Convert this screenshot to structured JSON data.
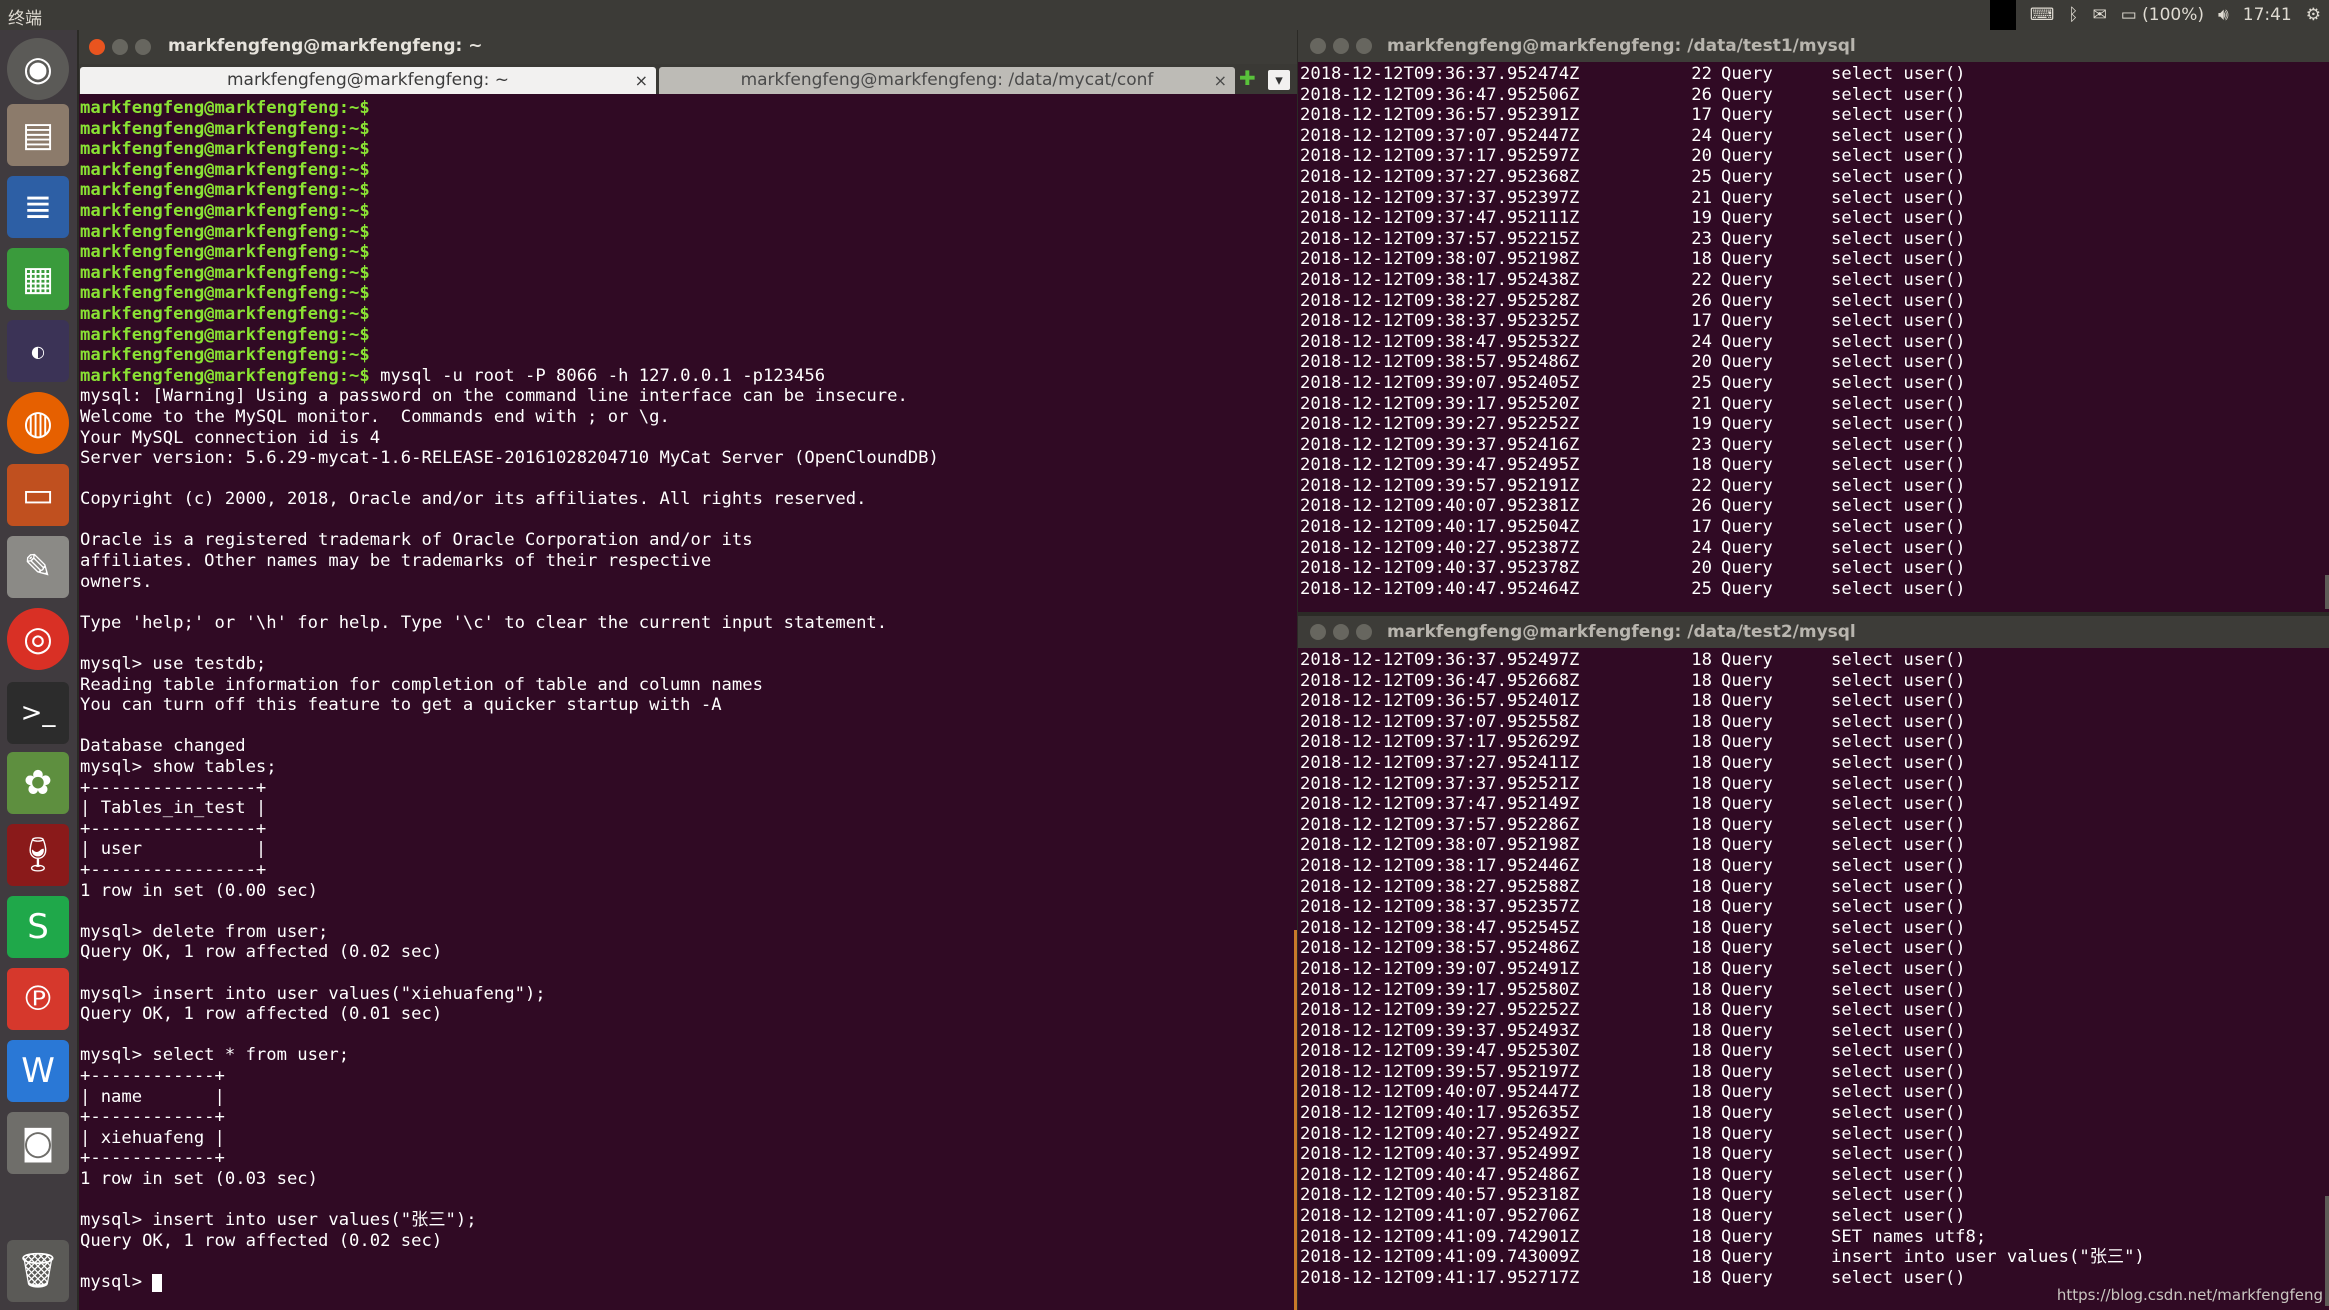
{
  "panel": {
    "app_title": "终端",
    "battery": "(100%)",
    "time": "17:41"
  },
  "left_terminal": {
    "title": "markfengfeng@markfengfeng: ~",
    "tabs": [
      {
        "label": "markfengfeng@markfengfeng: ~",
        "close": "×"
      },
      {
        "label": "markfengfeng@markfengfeng: /data/mycat/conf",
        "close": "×"
      }
    ],
    "new_tab_symbol": "✚",
    "menu_symbol": "▾",
    "prompt": "markfengfeng@markfengfeng:~$",
    "empty_prompts": 13,
    "command": " mysql -u root -P 8066 -h 127.0.0.1 -p123456",
    "output_lines": [
      "mysql: [Warning] Using a password on the command line interface can be insecure.",
      "Welcome to the MySQL monitor.  Commands end with ; or \\g.",
      "Your MySQL connection id is 4",
      "Server version: 5.6.29-mycat-1.6-RELEASE-20161028204710 MyCat Server (OpenCloundDB)",
      "",
      "Copyright (c) 2000, 2018, Oracle and/or its affiliates. All rights reserved.",
      "",
      "Oracle is a registered trademark of Oracle Corporation and/or its",
      "affiliates. Other names may be trademarks of their respective",
      "owners.",
      "",
      "Type 'help;' or '\\h' for help. Type '\\c' to clear the current input statement.",
      "",
      "mysql> use testdb;",
      "Reading table information for completion of table and column names",
      "You can turn off this feature to get a quicker startup with -A",
      "",
      "Database changed",
      "mysql> show tables;",
      "+----------------+",
      "| Tables_in_test |",
      "+----------------+",
      "| user           |",
      "+----------------+",
      "1 row in set (0.00 sec)",
      "",
      "mysql> delete from user;",
      "Query OK, 1 row affected (0.02 sec)",
      "",
      "mysql> insert into user values(\"xiehuafeng\");",
      "Query OK, 1 row affected (0.01 sec)",
      "",
      "mysql> select * from user;",
      "+------------+",
      "| name       |",
      "+------------+",
      "| xiehuafeng |",
      "+------------+",
      "1 row in set (0.03 sec)",
      "",
      "mysql> insert into user values(\"张三\");",
      "Query OK, 1 row affected (0.02 sec)",
      ""
    ],
    "final_prompt": "mysql> "
  },
  "right_top_terminal": {
    "title": "markfengfeng@markfengfeng: /data/test1/mysql",
    "rows": [
      [
        "2018-12-12T09:36:37.952474Z",
        "22",
        "Query",
        "select user()"
      ],
      [
        "2018-12-12T09:36:47.952506Z",
        "26",
        "Query",
        "select user()"
      ],
      [
        "2018-12-12T09:36:57.952391Z",
        "17",
        "Query",
        "select user()"
      ],
      [
        "2018-12-12T09:37:07.952447Z",
        "24",
        "Query",
        "select user()"
      ],
      [
        "2018-12-12T09:37:17.952597Z",
        "20",
        "Query",
        "select user()"
      ],
      [
        "2018-12-12T09:37:27.952368Z",
        "25",
        "Query",
        "select user()"
      ],
      [
        "2018-12-12T09:37:37.952397Z",
        "21",
        "Query",
        "select user()"
      ],
      [
        "2018-12-12T09:37:47.952111Z",
        "19",
        "Query",
        "select user()"
      ],
      [
        "2018-12-12T09:37:57.952215Z",
        "23",
        "Query",
        "select user()"
      ],
      [
        "2018-12-12T09:38:07.952198Z",
        "18",
        "Query",
        "select user()"
      ],
      [
        "2018-12-12T09:38:17.952438Z",
        "22",
        "Query",
        "select user()"
      ],
      [
        "2018-12-12T09:38:27.952528Z",
        "26",
        "Query",
        "select user()"
      ],
      [
        "2018-12-12T09:38:37.952325Z",
        "17",
        "Query",
        "select user()"
      ],
      [
        "2018-12-12T09:38:47.952532Z",
        "24",
        "Query",
        "select user()"
      ],
      [
        "2018-12-12T09:38:57.952486Z",
        "20",
        "Query",
        "select user()"
      ],
      [
        "2018-12-12T09:39:07.952405Z",
        "25",
        "Query",
        "select user()"
      ],
      [
        "2018-12-12T09:39:17.952520Z",
        "21",
        "Query",
        "select user()"
      ],
      [
        "2018-12-12T09:39:27.952252Z",
        "19",
        "Query",
        "select user()"
      ],
      [
        "2018-12-12T09:39:37.952416Z",
        "23",
        "Query",
        "select user()"
      ],
      [
        "2018-12-12T09:39:47.952495Z",
        "18",
        "Query",
        "select user()"
      ],
      [
        "2018-12-12T09:39:57.952191Z",
        "22",
        "Query",
        "select user()"
      ],
      [
        "2018-12-12T09:40:07.952381Z",
        "26",
        "Query",
        "select user()"
      ],
      [
        "2018-12-12T09:40:17.952504Z",
        "17",
        "Query",
        "select user()"
      ],
      [
        "2018-12-12T09:40:27.952387Z",
        "24",
        "Query",
        "select user()"
      ],
      [
        "2018-12-12T09:40:37.952378Z",
        "20",
        "Query",
        "select user()"
      ],
      [
        "2018-12-12T09:40:47.952464Z",
        "25",
        "Query",
        "select user()"
      ]
    ]
  },
  "right_bottom_terminal": {
    "title": "markfengfeng@markfengfeng: /data/test2/mysql",
    "rows": [
      [
        "2018-12-12T09:36:37.952497Z",
        "18",
        "Query",
        "select user()"
      ],
      [
        "2018-12-12T09:36:47.952668Z",
        "18",
        "Query",
        "select user()"
      ],
      [
        "2018-12-12T09:36:57.952401Z",
        "18",
        "Query",
        "select user()"
      ],
      [
        "2018-12-12T09:37:07.952558Z",
        "18",
        "Query",
        "select user()"
      ],
      [
        "2018-12-12T09:37:17.952629Z",
        "18",
        "Query",
        "select user()"
      ],
      [
        "2018-12-12T09:37:27.952411Z",
        "18",
        "Query",
        "select user()"
      ],
      [
        "2018-12-12T09:37:37.952521Z",
        "18",
        "Query",
        "select user()"
      ],
      [
        "2018-12-12T09:37:47.952149Z",
        "18",
        "Query",
        "select user()"
      ],
      [
        "2018-12-12T09:37:57.952286Z",
        "18",
        "Query",
        "select user()"
      ],
      [
        "2018-12-12T09:38:07.952198Z",
        "18",
        "Query",
        "select user()"
      ],
      [
        "2018-12-12T09:38:17.952446Z",
        "18",
        "Query",
        "select user()"
      ],
      [
        "2018-12-12T09:38:27.952588Z",
        "18",
        "Query",
        "select user()"
      ],
      [
        "2018-12-12T09:38:37.952357Z",
        "18",
        "Query",
        "select user()"
      ],
      [
        "2018-12-12T09:38:47.952545Z",
        "18",
        "Query",
        "select user()"
      ],
      [
        "2018-12-12T09:38:57.952486Z",
        "18",
        "Query",
        "select user()"
      ],
      [
        "2018-12-12T09:39:07.952491Z",
        "18",
        "Query",
        "select user()"
      ],
      [
        "2018-12-12T09:39:17.952580Z",
        "18",
        "Query",
        "select user()"
      ],
      [
        "2018-12-12T09:39:27.952252Z",
        "18",
        "Query",
        "select user()"
      ],
      [
        "2018-12-12T09:39:37.952493Z",
        "18",
        "Query",
        "select user()"
      ],
      [
        "2018-12-12T09:39:47.952530Z",
        "18",
        "Query",
        "select user()"
      ],
      [
        "2018-12-12T09:39:57.952197Z",
        "18",
        "Query",
        "select user()"
      ],
      [
        "2018-12-12T09:40:07.952447Z",
        "18",
        "Query",
        "select user()"
      ],
      [
        "2018-12-12T09:40:17.952635Z",
        "18",
        "Query",
        "select user()"
      ],
      [
        "2018-12-12T09:40:27.952492Z",
        "18",
        "Query",
        "select user()"
      ],
      [
        "2018-12-12T09:40:37.952499Z",
        "18",
        "Query",
        "select user()"
      ],
      [
        "2018-12-12T09:40:47.952486Z",
        "18",
        "Query",
        "select user()"
      ],
      [
        "2018-12-12T09:40:57.952318Z",
        "18",
        "Query",
        "select user()"
      ],
      [
        "2018-12-12T09:41:07.952706Z",
        "18",
        "Query",
        "select user()"
      ],
      [
        "2018-12-12T09:41:09.742901Z",
        "18",
        "Query",
        "SET names utf8;"
      ],
      [
        "2018-12-12T09:41:09.743009Z",
        "18",
        "Query",
        "insert into user values(\"张三\")"
      ],
      [
        "2018-12-12T09:41:17.952717Z",
        "18",
        "Query",
        "select user()"
      ]
    ]
  },
  "watermark": "https://blog.csdn.net/markfengfeng",
  "colors": {
    "terminal_bg": "#300a24",
    "prompt_green": "#8ae234",
    "close_button": "#e9541f"
  },
  "launcher_icons": [
    "dash-icon",
    "files-icon",
    "writer-icon",
    "calc-icon",
    "eclipse-icon",
    "firefox-icon",
    "impress-icon",
    "text-editor-icon",
    "chrome-icon",
    "terminal-icon",
    "shotwell-icon",
    "wine-icon",
    "wps-spreadsheet-icon",
    "wps-pdf-icon",
    "wps-writer-icon",
    "screenshot-icon",
    "trash-icon"
  ]
}
